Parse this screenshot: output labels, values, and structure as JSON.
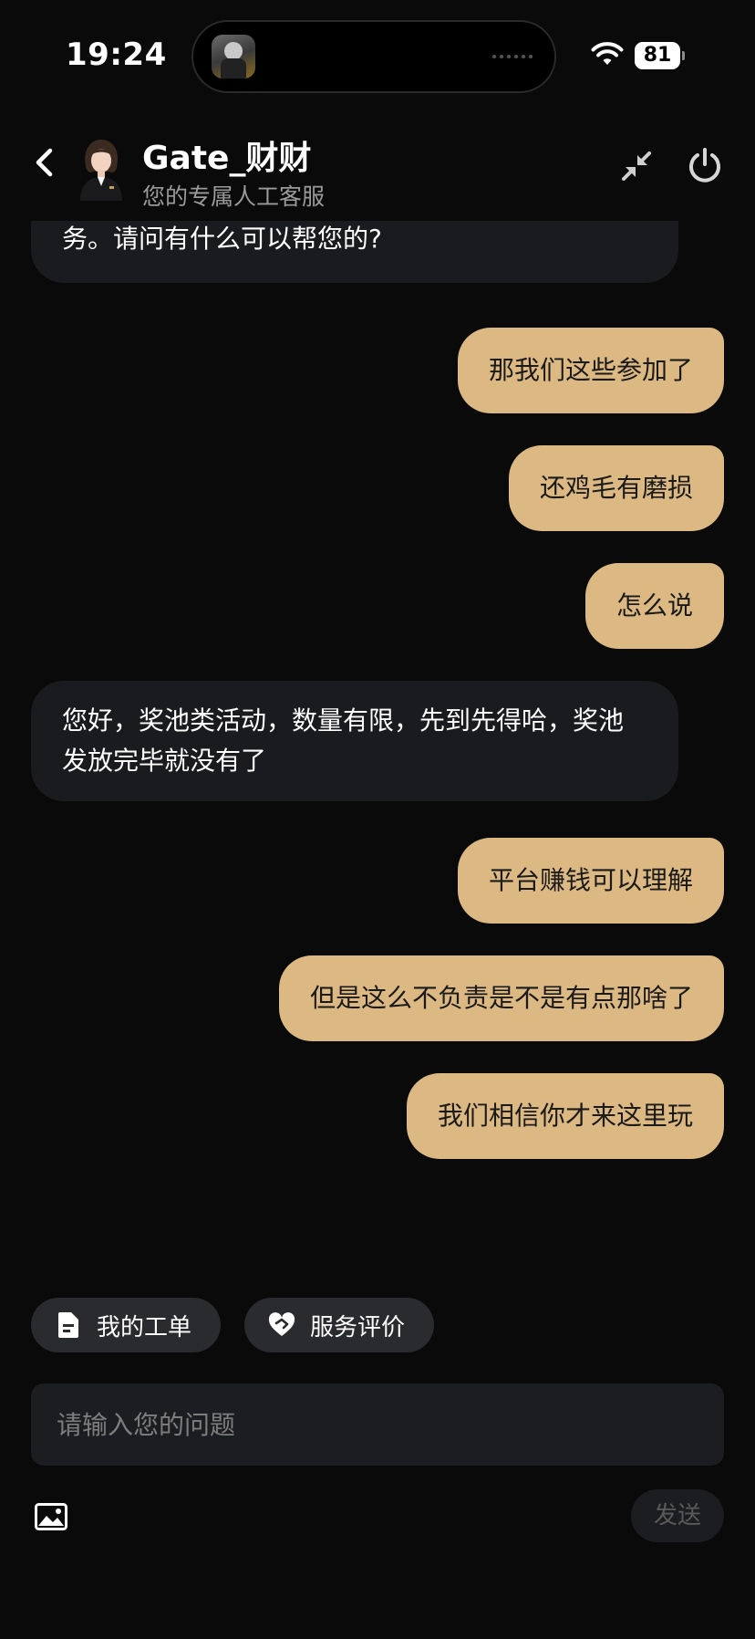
{
  "status_bar": {
    "time": "19:24",
    "battery": "81",
    "battery_level": 0.81,
    "icons": [
      "wifi-icon",
      "battery-icon"
    ]
  },
  "header": {
    "agent_name": "Gate_财财",
    "subtitle": "您的专属人工客服",
    "icons": [
      "back-arrow-icon",
      "minimize-arrows-icon",
      "power-icon"
    ]
  },
  "messages": [
    {
      "sender": "agent",
      "text": "务。请问有什么可以帮您的?"
    },
    {
      "sender": "user",
      "text": "那我们这些参加了"
    },
    {
      "sender": "user",
      "text": "还鸡毛有磨损"
    },
    {
      "sender": "user",
      "text": "怎么说"
    },
    {
      "sender": "agent",
      "text": "您好，奖池类活动，数量有限，先到先得哈，奖池发放完毕就没有了"
    },
    {
      "sender": "user",
      "text": "平台赚钱可以理解"
    },
    {
      "sender": "user",
      "text": "但是这么不负责是不是有点那啥了"
    },
    {
      "sender": "user",
      "text": "我们相信你才来这里玩"
    }
  ],
  "quick_actions": [
    {
      "label": "我的工单",
      "icon": "document-icon"
    },
    {
      "label": "服务评价",
      "icon": "heart-handshake-icon"
    }
  ],
  "input": {
    "placeholder": "请输入您的问题",
    "value": ""
  },
  "toolbar": {
    "image_icon": "image-icon",
    "send_label": "发送"
  },
  "colors": {
    "background": "#0a0a0a",
    "agent_bubble": "#1a1b1e",
    "user_bubble": "#dcb883",
    "chip": "#2a2b2e",
    "input": "#1c1d20"
  }
}
